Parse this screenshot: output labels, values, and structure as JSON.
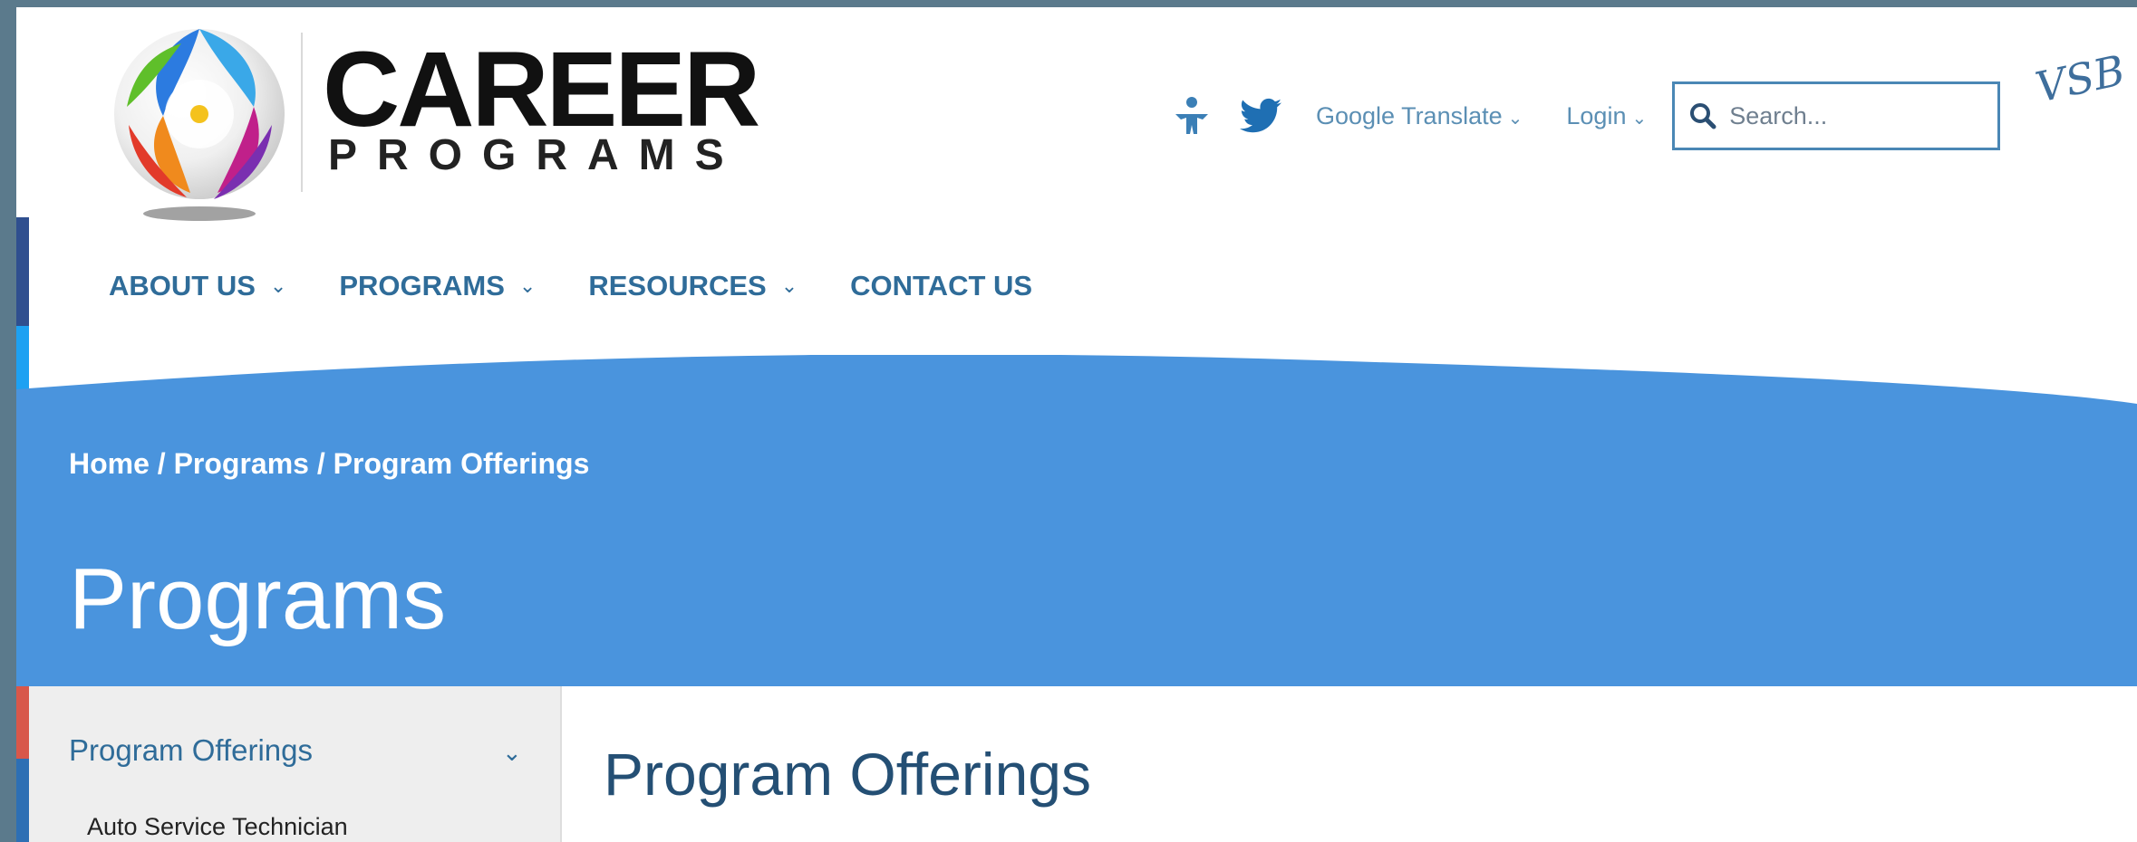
{
  "header": {
    "brand_main": "CAREER",
    "brand_sub": "PROGRAMS",
    "google_translate": "Google Translate",
    "login": "Login",
    "search_placeholder": "Search...",
    "signature": "VSB"
  },
  "nav": {
    "items": [
      {
        "label": "ABOUT US",
        "has_dropdown": true
      },
      {
        "label": "PROGRAMS",
        "has_dropdown": true
      },
      {
        "label": "RESOURCES",
        "has_dropdown": true
      },
      {
        "label": "CONTACT US",
        "has_dropdown": false
      }
    ]
  },
  "banner": {
    "breadcrumb": [
      "Home",
      "Programs",
      "Program Offerings"
    ],
    "title": "Programs",
    "color": "#4a94dd"
  },
  "sidebar": {
    "heading": "Program Offerings",
    "items": [
      "Auto Service Technician"
    ]
  },
  "content": {
    "title": "Program Offerings"
  },
  "colors": {
    "nav_text": "#2f6c99",
    "link_text": "#5b8fb4",
    "banner": "#4a94dd",
    "twitter": "#1da1f2"
  },
  "icons": [
    "accessibility-icon",
    "twitter-icon",
    "search-icon",
    "chevron-down-icon"
  ]
}
